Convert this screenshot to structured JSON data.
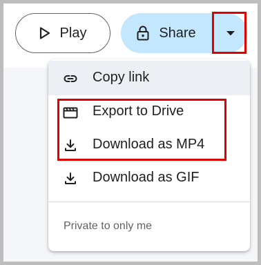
{
  "toolbar": {
    "play_label": "Play",
    "share_label": "Share"
  },
  "share_menu": {
    "items": [
      {
        "label": "Copy link",
        "icon": "link-icon"
      },
      {
        "label": "Export to Drive",
        "icon": "movie-clapper-icon"
      },
      {
        "label": "Download as MP4",
        "icon": "download-icon"
      },
      {
        "label": "Download as GIF",
        "icon": "download-icon"
      }
    ],
    "footer": "Private to only me"
  },
  "colors": {
    "share_button_bg": "#c2e7ff",
    "highlight_box": "#e00000",
    "menu_hover": "#eceff3"
  }
}
